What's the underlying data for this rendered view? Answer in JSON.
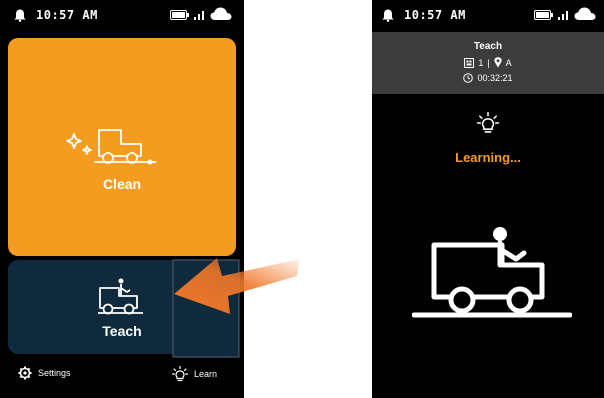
{
  "left_screen": {
    "status": {
      "time": "10:57 AM"
    },
    "clean_card": {
      "label": "Clean",
      "icon": "clean-vehicle-icon",
      "color": "#F39C1F"
    },
    "teach_card": {
      "label": "Teach",
      "icon": "teach-vehicle-icon",
      "color": "#0F2A3C"
    },
    "bottom": {
      "settings_label": "Settings",
      "learn_label": "Learn"
    }
  },
  "right_screen": {
    "status": {
      "time": "10:57 AM"
    },
    "header": {
      "title": "Teach",
      "map_number": "1",
      "separator": "|",
      "location": "A",
      "elapsed": "00:32:21"
    },
    "learning_text": "Learning...",
    "accent_color": "#F39C1F"
  },
  "annotation": {
    "arrow_color": "#F0782A"
  }
}
